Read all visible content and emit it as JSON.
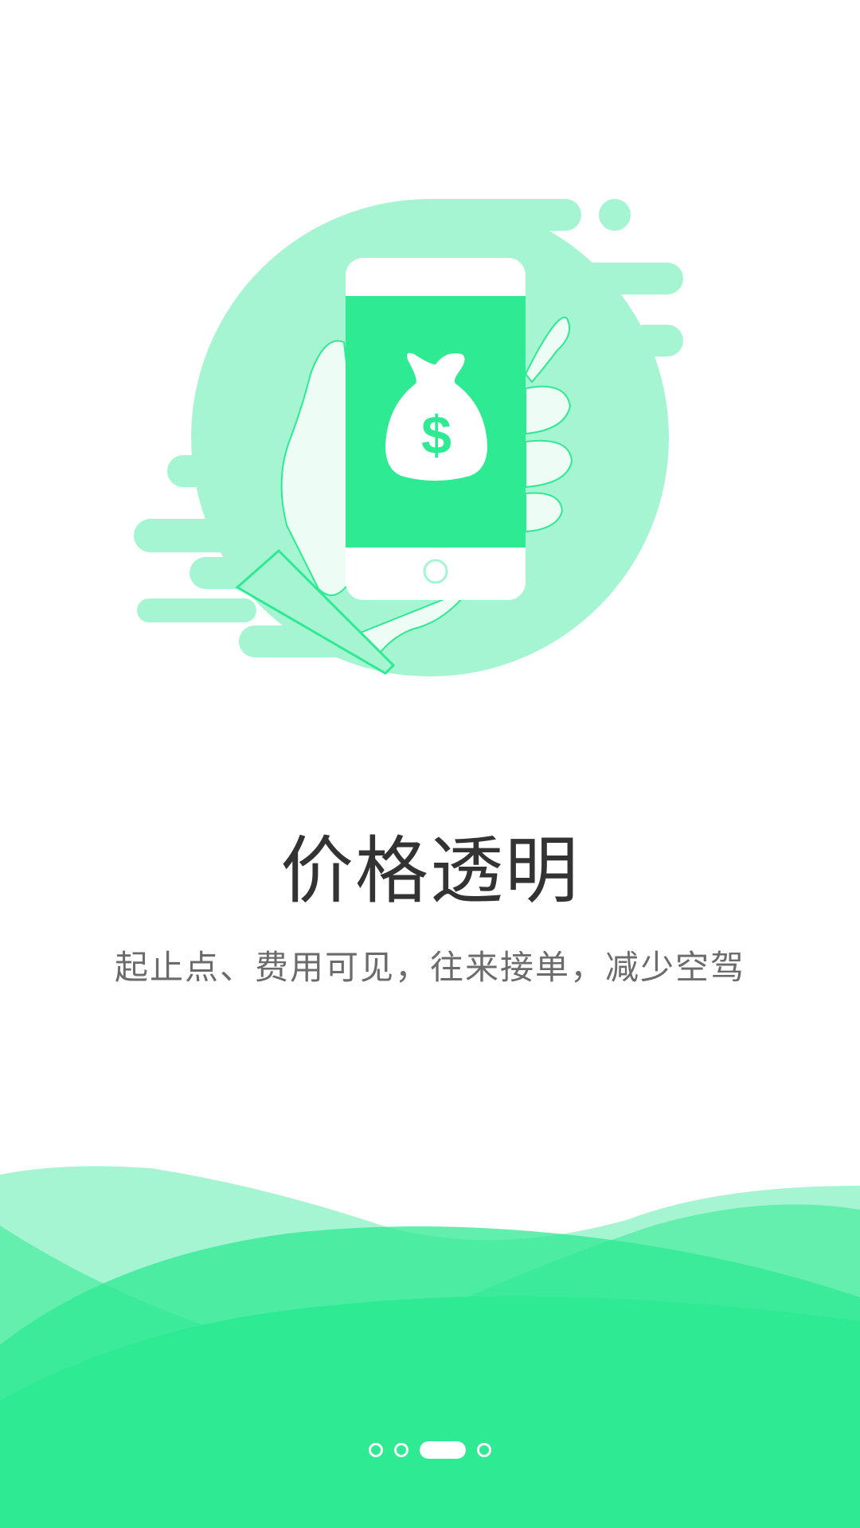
{
  "onboarding": {
    "title": "价格透明",
    "subtitle": "起止点、费用可见，往来接单，减少空驾",
    "illustration_icon": "money-bag-phone-icon",
    "page_indicator": {
      "total": 4,
      "active_index": 2
    }
  },
  "colors": {
    "primary_green": "#2EEA92",
    "light_green": "#A6F5D2",
    "title_text": "#333333",
    "subtitle_text": "#6B6B6B"
  }
}
